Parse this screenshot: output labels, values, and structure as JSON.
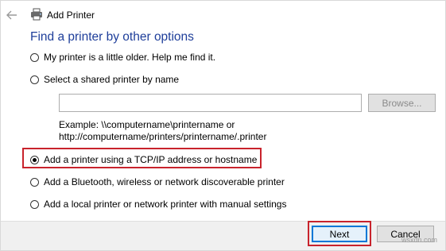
{
  "window": {
    "title": "Add Printer"
  },
  "icons": {
    "back": "back-arrow-icon",
    "printer": "printer-icon"
  },
  "heading": "Find a printer by other options",
  "options": [
    {
      "label": "My printer is a little older. Help me find it.",
      "checked": false
    },
    {
      "label": "Select a shared printer by name",
      "checked": false
    },
    {
      "label": "Add a printer using a TCP/IP address or hostname",
      "checked": true
    },
    {
      "label": "Add a Bluetooth, wireless or network discoverable printer",
      "checked": false
    },
    {
      "label": "Add a local printer or network printer with manual settings",
      "checked": false
    }
  ],
  "shared": {
    "input_value": "",
    "browse_label": "Browse...",
    "example_line1": "Example: \\\\computername\\printername or",
    "example_line2": "http://computername/printers/printername/.printer"
  },
  "buttons": {
    "next": "Next",
    "cancel": "Cancel"
  },
  "watermark": "wsxdn.com",
  "colors": {
    "heading": "#1e3e9a",
    "highlight": "#c8232c",
    "default_button_border": "#0078d7"
  }
}
